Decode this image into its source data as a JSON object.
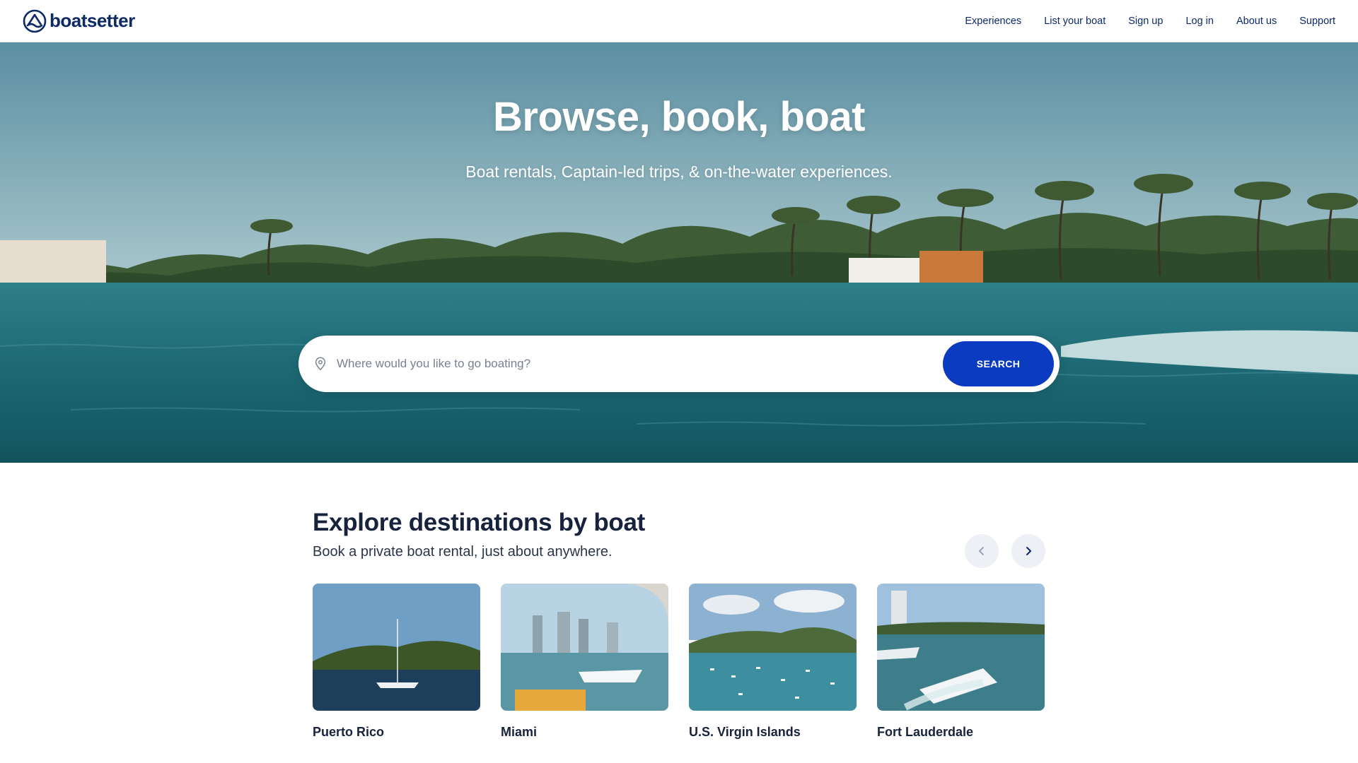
{
  "header": {
    "brand": "boatsetter",
    "nav": [
      "Experiences",
      "List your boat",
      "Sign up",
      "Log in",
      "About us",
      "Support"
    ]
  },
  "hero": {
    "title": "Browse, book, boat",
    "subtitle": "Boat rentals, Captain-led trips, & on-the-water experiences.",
    "search": {
      "placeholder": "Where would you like to go boating?",
      "button": "SEARCH"
    }
  },
  "destinations": {
    "title": "Explore destinations by boat",
    "subtitle": "Book a private boat rental, just about anywhere.",
    "cards": [
      {
        "name": "Puerto Rico"
      },
      {
        "name": "Miami"
      },
      {
        "name": "U.S. Virgin Islands"
      },
      {
        "name": "Fort Lauderdale"
      }
    ]
  },
  "colors": {
    "brand_navy": "#0d2a66",
    "search_button": "#0b3bc0",
    "text": "#17233c"
  },
  "icons": [
    "boatsetter-logo-icon",
    "location-pin-icon",
    "chevron-left-icon",
    "chevron-right-icon"
  ]
}
